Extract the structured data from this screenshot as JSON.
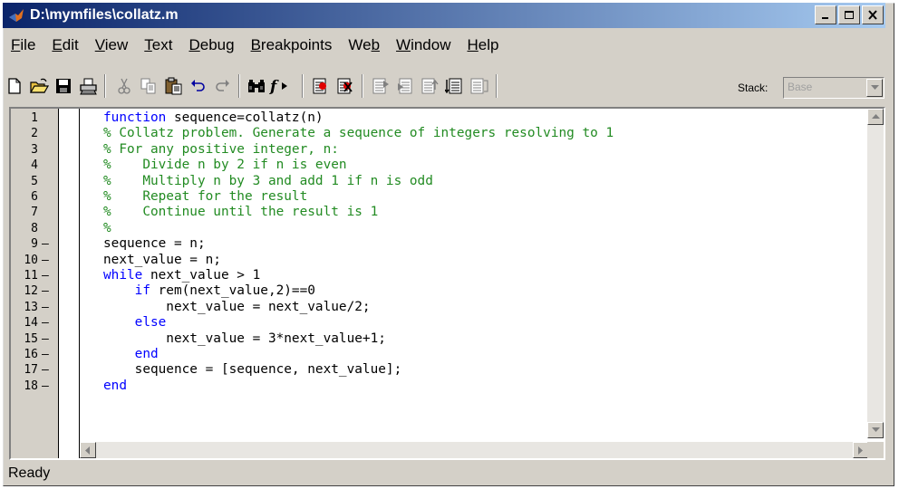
{
  "window": {
    "title": "D:\\mymfiles\\collatz.m"
  },
  "menu": [
    {
      "label": "File",
      "u": "F",
      "rest": "ile"
    },
    {
      "label": "Edit",
      "u": "E",
      "rest": "dit"
    },
    {
      "label": "View",
      "u": "V",
      "rest": "iew"
    },
    {
      "label": "Text",
      "u": "T",
      "rest": "ext"
    },
    {
      "label": "Debug",
      "u": "D",
      "rest": "ebug"
    },
    {
      "label": "Breakpoints",
      "u": "B",
      "rest": "reakpoints"
    },
    {
      "label": "Web",
      "pre": "We",
      "u": "b",
      "rest": ""
    },
    {
      "label": "Window",
      "u": "W",
      "rest": "indow"
    },
    {
      "label": "Help",
      "u": "H",
      "rest": "elp"
    }
  ],
  "toolbar": {
    "stack_label": "Stack:",
    "stack_value": "Base"
  },
  "editor": {
    "lines": [
      {
        "n": "1",
        "bp": "",
        "code": "function sequence=collatz(n)",
        "kind": "kw-first"
      },
      {
        "n": "2",
        "bp": "",
        "code": "% Collatz problem. Generate a sequence of integers resolving to 1",
        "kind": "cm"
      },
      {
        "n": "3",
        "bp": "",
        "code": "% For any positive integer, n:",
        "kind": "cm"
      },
      {
        "n": "4",
        "bp": "",
        "code": "%    Divide n by 2 if n is even",
        "kind": "cm"
      },
      {
        "n": "5",
        "bp": "",
        "code": "%    Multiply n by 3 and add 1 if n is odd",
        "kind": "cm"
      },
      {
        "n": "6",
        "bp": "",
        "code": "%    Repeat for the result",
        "kind": "cm"
      },
      {
        "n": "7",
        "bp": "",
        "code": "%    Continue until the result is 1",
        "kind": "cm"
      },
      {
        "n": "8",
        "bp": "",
        "code": "%",
        "kind": "cm"
      },
      {
        "n": "9",
        "bp": "–",
        "code": "sequence = n;",
        "kind": "plain"
      },
      {
        "n": "10",
        "bp": "–",
        "code": "next_value = n;",
        "kind": "plain"
      },
      {
        "n": "11",
        "bp": "–",
        "code": "while next_value > 1",
        "kind": "kw-first"
      },
      {
        "n": "12",
        "bp": "–",
        "code": "    if rem(next_value,2)==0",
        "kind": "kw-first"
      },
      {
        "n": "13",
        "bp": "–",
        "code": "        next_value = next_value/2;",
        "kind": "plain"
      },
      {
        "n": "14",
        "bp": "–",
        "code": "    else",
        "kind": "kw"
      },
      {
        "n": "15",
        "bp": "–",
        "code": "        next_value = 3*next_value+1;",
        "kind": "plain"
      },
      {
        "n": "16",
        "bp": "–",
        "code": "    end",
        "kind": "kw"
      },
      {
        "n": "17",
        "bp": "–",
        "code": "    sequence = [sequence, next_value];",
        "kind": "plain"
      },
      {
        "n": "18",
        "bp": "–",
        "code": "end",
        "kind": "kw"
      }
    ]
  },
  "status": {
    "text": "Ready"
  }
}
